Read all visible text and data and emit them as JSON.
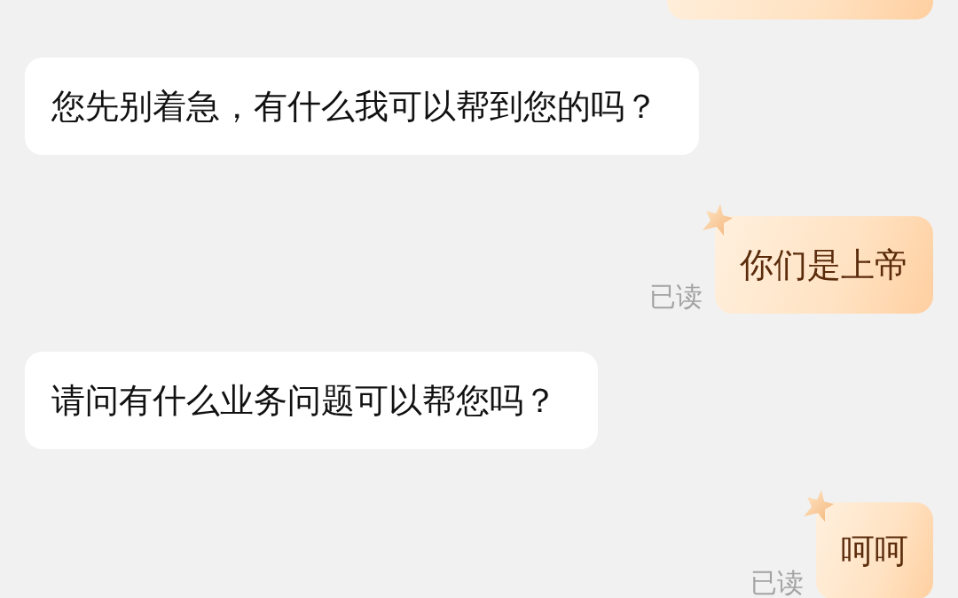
{
  "messages": [
    {
      "kind": "sent"
    },
    {
      "kind": "received",
      "text": "您先别着急，有什么我可以帮到您的吗？"
    },
    {
      "kind": "sent",
      "text": "你们是上帝",
      "status": "已读"
    },
    {
      "kind": "received",
      "text": "请问有什么业务问题可以帮您吗？"
    },
    {
      "kind": "sent",
      "text": "呵呵",
      "status": "已读"
    }
  ]
}
